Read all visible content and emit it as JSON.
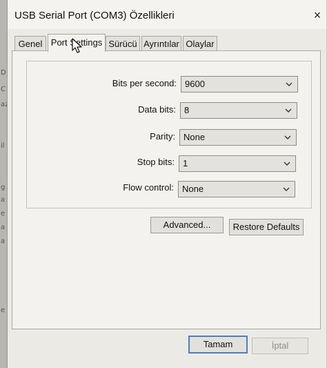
{
  "background_window": {
    "edge_glyphs": [
      "D",
      "C",
      "az",
      "il",
      "g",
      "a",
      "e",
      "a",
      "a",
      "e"
    ]
  },
  "dialog": {
    "title": "USB Serial Port (COM3) Özellikleri",
    "close_label": "×"
  },
  "tabs": [
    {
      "label": "Genel",
      "active": false
    },
    {
      "label": "Port Settings",
      "active": true
    },
    {
      "label": "Sürücü",
      "active": false
    },
    {
      "label": "Ayrıntılar",
      "active": false
    },
    {
      "label": "Olaylar",
      "active": false
    }
  ],
  "port_settings": {
    "bits_per_second": {
      "label": "Bits per second:",
      "value": "9600"
    },
    "data_bits": {
      "label": "Data bits:",
      "value": "8"
    },
    "parity": {
      "label": "Parity:",
      "value": "None"
    },
    "stop_bits": {
      "label": "Stop bits:",
      "value": "1"
    },
    "flow_control": {
      "label": "Flow control:",
      "value": "None"
    }
  },
  "buttons": {
    "advanced": "Advanced...",
    "restore_defaults": "Restore Defaults",
    "ok": "Tamam",
    "cancel": "İptal"
  },
  "icons": {
    "close": "close-icon",
    "dropdown": "chevron-down-icon",
    "cursor": "mouse-pointer-icon"
  },
  "colors": {
    "default_button_border": "#4a7fc1"
  }
}
